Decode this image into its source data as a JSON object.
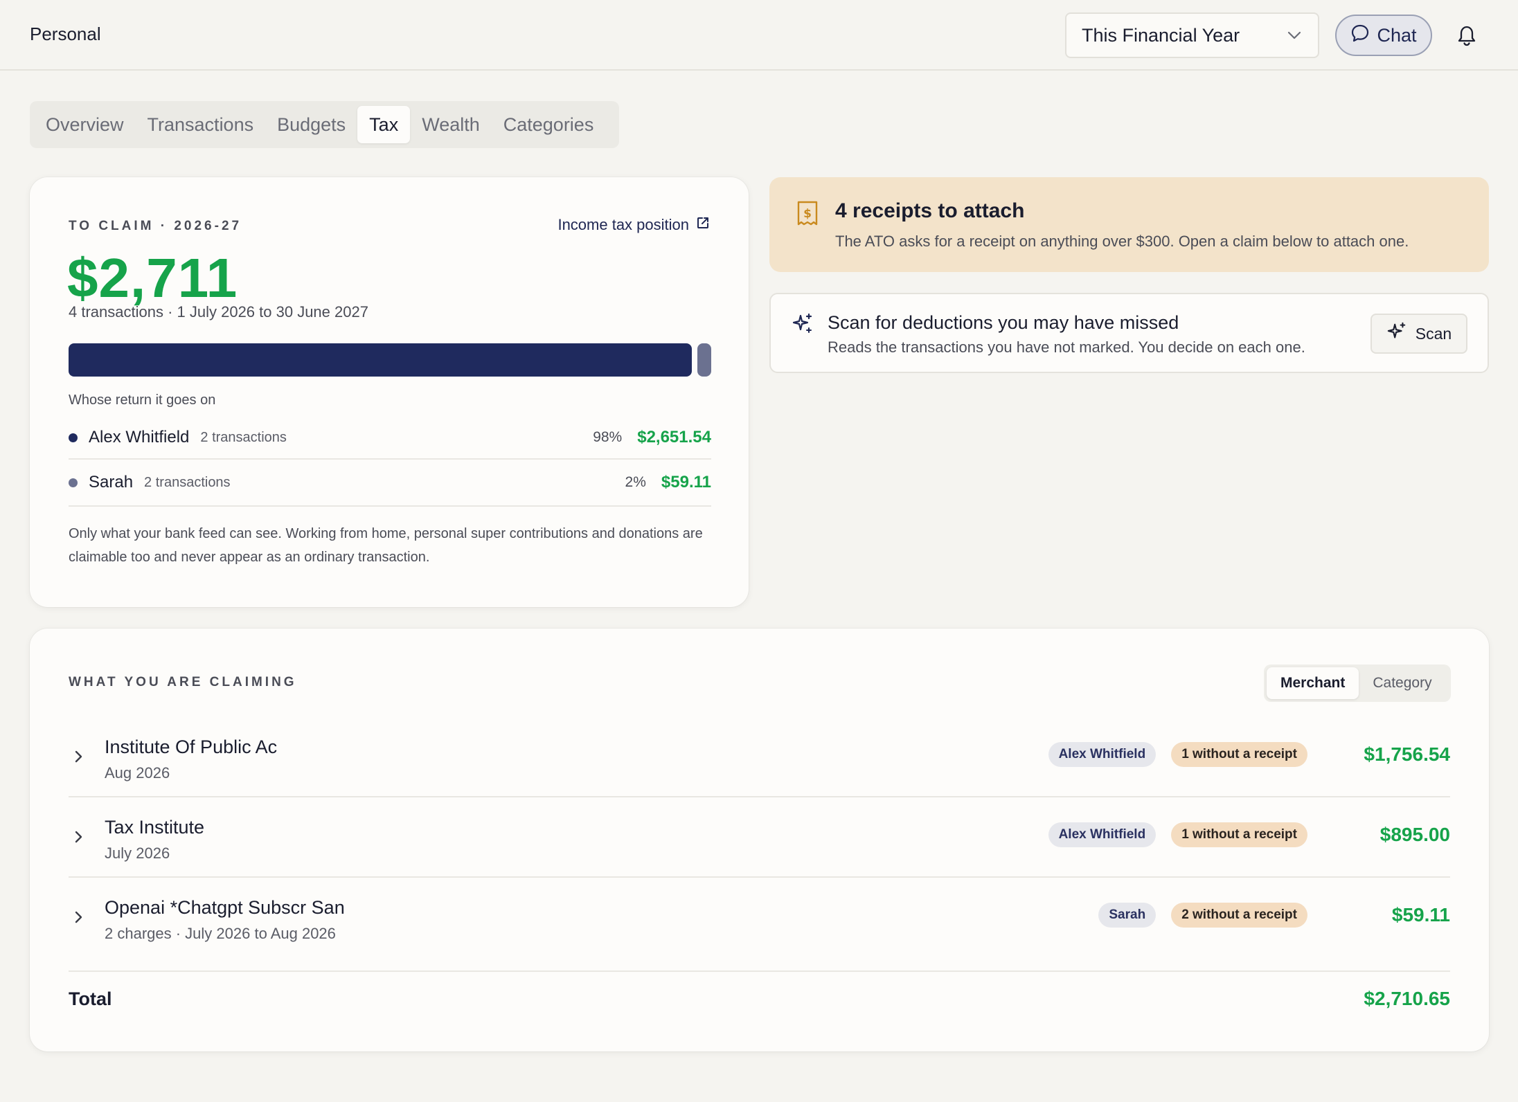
{
  "header": {
    "brand": "Personal",
    "period_select": "This Financial Year",
    "chat_label": "Chat"
  },
  "tabs": [
    {
      "label": "Overview",
      "active": false
    },
    {
      "label": "Transactions",
      "active": false
    },
    {
      "label": "Budgets",
      "active": false
    },
    {
      "label": "Tax",
      "active": true
    },
    {
      "label": "Wealth",
      "active": false
    },
    {
      "label": "Categories",
      "active": false
    }
  ],
  "claim": {
    "eyebrow": "TO CLAIM · 2026-27",
    "income_link": "Income tax position",
    "amount": "$2,711",
    "subtitle": "4 transactions · 1 July 2026 to 30 June 2027",
    "split_fractions": [
      0.98,
      0.02
    ],
    "whose_label": "Whose return it goes on",
    "people": [
      {
        "name": "Alex Whitfield",
        "count": "2 transactions",
        "pct": "98%",
        "amount": "$2,651.54",
        "color": "#1f2a5e"
      },
      {
        "name": "Sarah",
        "count": "2 transactions",
        "pct": "2%",
        "amount": "$59.11",
        "color": "#6b7190"
      }
    ],
    "note": "Only what your bank feed can see. Working from home, personal super contributions and donations are claimable too and never appear as an ordinary transaction."
  },
  "receipts": {
    "title": "4 receipts to attach",
    "text": "The ATO asks for a receipt on anything over $300. Open a claim below to attach one."
  },
  "scan": {
    "title": "Scan for deductions you may have missed",
    "text": "Reads the transactions you have not marked. You decide on each one.",
    "button": "Scan"
  },
  "claiming": {
    "eyebrow": "WHAT YOU ARE CLAIMING",
    "toggle": [
      {
        "label": "Merchant",
        "active": true
      },
      {
        "label": "Category",
        "active": false
      }
    ],
    "rows": [
      {
        "merchant": "Institute Of Public Ac",
        "sub": "Aug 2026",
        "person": "Alex Whitfield",
        "receipt": "1 without a receipt",
        "amount": "$1,756.54"
      },
      {
        "merchant": "Tax Institute",
        "sub": "July 2026",
        "person": "Alex Whitfield",
        "receipt": "1 without a receipt",
        "amount": "$895.00"
      },
      {
        "merchant": "Openai *Chatgpt Subscr San",
        "sub": "2 charges · July 2026 to Aug 2026",
        "person": "Sarah",
        "receipt": "2 without a receipt",
        "amount": "$59.11"
      }
    ],
    "total_label": "Total",
    "total_value": "$2,710.65"
  },
  "icons": {
    "chevron": "chevron-down-icon",
    "chat": "chat-bubble-icon",
    "bell": "bell-icon",
    "external": "external-link-icon",
    "receipt": "receipt-icon",
    "sparkle": "sparkle-icon",
    "row_chevron": "chevron-right-icon"
  },
  "colors": {
    "accent_green": "#16a34a",
    "navy": "#1f2a5e",
    "receipt_banner": "#f3e3ca"
  }
}
